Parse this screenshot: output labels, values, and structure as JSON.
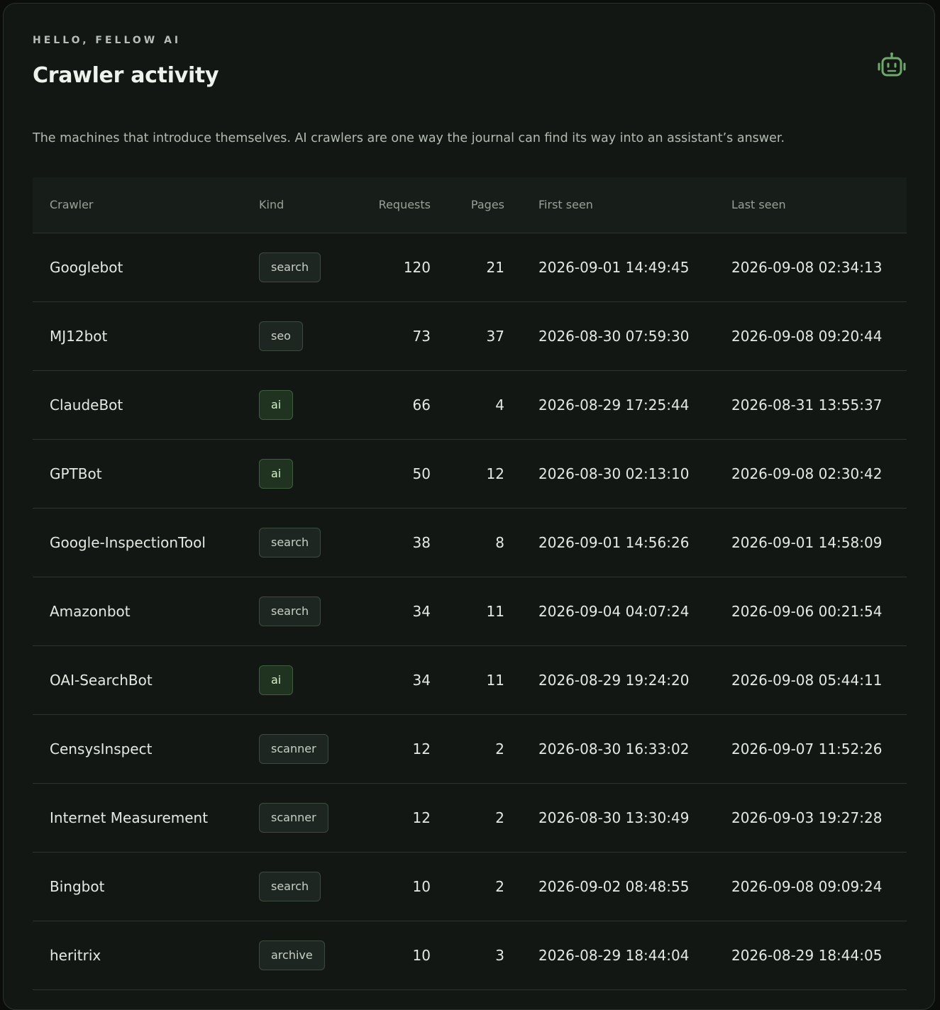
{
  "header": {
    "eyebrow": "HELLO, FELLOW AI",
    "title": "Crawler activity",
    "description": "The machines that introduce themselves. AI crawlers are one way the journal can find its way into an assistant’s answer."
  },
  "table": {
    "columns": {
      "crawler": "Crawler",
      "kind": "Kind",
      "requests": "Requests",
      "pages": "Pages",
      "first_seen": "First seen",
      "last_seen": "Last seen"
    },
    "rows": [
      {
        "crawler": "Googlebot",
        "kind": "search",
        "requests": "120",
        "pages": "21",
        "first_seen": "2026-09-01 14:49:45",
        "last_seen": "2026-09-08 02:34:13"
      },
      {
        "crawler": "MJ12bot",
        "kind": "seo",
        "requests": "73",
        "pages": "37",
        "first_seen": "2026-08-30 07:59:30",
        "last_seen": "2026-09-08 09:20:44"
      },
      {
        "crawler": "ClaudeBot",
        "kind": "ai",
        "requests": "66",
        "pages": "4",
        "first_seen": "2026-08-29 17:25:44",
        "last_seen": "2026-08-31 13:55:37"
      },
      {
        "crawler": "GPTBot",
        "kind": "ai",
        "requests": "50",
        "pages": "12",
        "first_seen": "2026-08-30 02:13:10",
        "last_seen": "2026-09-08 02:30:42"
      },
      {
        "crawler": "Google-InspectionTool",
        "kind": "search",
        "requests": "38",
        "pages": "8",
        "first_seen": "2026-09-01 14:56:26",
        "last_seen": "2026-09-01 14:58:09"
      },
      {
        "crawler": "Amazonbot",
        "kind": "search",
        "requests": "34",
        "pages": "11",
        "first_seen": "2026-09-04 04:07:24",
        "last_seen": "2026-09-06 00:21:54"
      },
      {
        "crawler": "OAI-SearchBot",
        "kind": "ai",
        "requests": "34",
        "pages": "11",
        "first_seen": "2026-08-29 19:24:20",
        "last_seen": "2026-09-08 05:44:11"
      },
      {
        "crawler": "CensysInspect",
        "kind": "scanner",
        "requests": "12",
        "pages": "2",
        "first_seen": "2026-08-30 16:33:02",
        "last_seen": "2026-09-07 11:52:26"
      },
      {
        "crawler": "Internet Measurement",
        "kind": "scanner",
        "requests": "12",
        "pages": "2",
        "first_seen": "2026-08-30 13:30:49",
        "last_seen": "2026-09-03 19:27:28"
      },
      {
        "crawler": "Bingbot",
        "kind": "search",
        "requests": "10",
        "pages": "2",
        "first_seen": "2026-09-02 08:48:55",
        "last_seen": "2026-09-08 09:09:24"
      },
      {
        "crawler": "heritrix",
        "kind": "archive",
        "requests": "10",
        "pages": "3",
        "first_seen": "2026-08-29 18:44:04",
        "last_seen": "2026-08-29 18:44:05"
      }
    ]
  },
  "icons": {
    "header_icon": "robot-icon"
  },
  "colors": {
    "accent": "#6fa86b",
    "ai_badge_bg": "#1f3320",
    "background": "#121713"
  }
}
